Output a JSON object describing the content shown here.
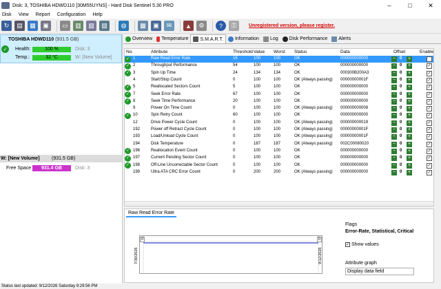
{
  "window": {
    "title": "Disk: 3, TOSHIBA HDWD110 [30M55UYNS]  -  Hard Disk Sentinel 5.30 PRO"
  },
  "menu": [
    "Disk",
    "View",
    "Report",
    "Configuration",
    "Help"
  ],
  "toolbar": {
    "unregistered": "Unregistered version, please register."
  },
  "disk": {
    "name": "TOSHIBA HDWD110",
    "size": "(931.5 GB)",
    "health_label": "Health:",
    "health_value": "100 %",
    "health_percent": 100,
    "health_disk": "Disk: 3",
    "temp_label": "Temp.:",
    "temp_value": "32 °C",
    "temp_volume": "W: [New Volume]"
  },
  "volume": {
    "name": "W: [New Volume]",
    "size": "(931.5 GB)",
    "free_label": "Free Space",
    "free_value": "931.4 GB",
    "free_disk": "Disk: 3"
  },
  "tabs": [
    "Overview",
    "Temperature",
    "S.M.A.R.T.",
    "Information",
    "Log",
    "Disk Performance",
    "Alerts"
  ],
  "smart": {
    "columns": [
      "No.",
      "Attribute",
      "Threshold",
      "Value",
      "Worst",
      "Status",
      "Data",
      "Offset",
      "Enable"
    ],
    "rows": [
      {
        "no": "1",
        "attr": "Raw Read Error Rate",
        "thr": "16",
        "val": "100",
        "worst": "100",
        "status": "OK",
        "data": "000000000000",
        "ok": true,
        "sel": true
      },
      {
        "no": "2",
        "attr": "Throughput Performance",
        "thr": "54",
        "val": "100",
        "worst": "100",
        "status": "OK",
        "data": "000000000000",
        "ok": true
      },
      {
        "no": "3",
        "attr": "Spin Up Time",
        "thr": "24",
        "val": "134",
        "worst": "134",
        "status": "OK",
        "data": "000300B200A3",
        "ok": true
      },
      {
        "no": "4",
        "attr": "Start/Stop Count",
        "thr": "0",
        "val": "100",
        "worst": "100",
        "status": "OK (Always passing)",
        "data": "00000000001F",
        "ok": false
      },
      {
        "no": "5",
        "attr": "Reallocated Sectors Count",
        "thr": "5",
        "val": "100",
        "worst": "100",
        "status": "OK",
        "data": "000000000000",
        "ok": true
      },
      {
        "no": "7",
        "attr": "Seek Error Rate",
        "thr": "67",
        "val": "100",
        "worst": "100",
        "status": "OK",
        "data": "000000000000",
        "ok": true
      },
      {
        "no": "8",
        "attr": "Seek Time Performance",
        "thr": "20",
        "val": "100",
        "worst": "100",
        "status": "OK",
        "data": "000000000000",
        "ok": true
      },
      {
        "no": "9",
        "attr": "Power On Time Count",
        "thr": "0",
        "val": "100",
        "worst": "100",
        "status": "OK (Always passing)",
        "data": "000000000008",
        "ok": false
      },
      {
        "no": "10",
        "attr": "Spin Retry Count",
        "thr": "60",
        "val": "100",
        "worst": "100",
        "status": "OK",
        "data": "000000000000",
        "ok": true
      },
      {
        "no": "12",
        "attr": "Drive Power Cycle Count",
        "thr": "0",
        "val": "100",
        "worst": "100",
        "status": "OK (Always passing)",
        "data": "000000000019",
        "ok": false
      },
      {
        "no": "192",
        "attr": "Power off Retract Cycle Count",
        "thr": "0",
        "val": "100",
        "worst": "100",
        "status": "OK (Always passing)",
        "data": "00000000001F",
        "ok": false
      },
      {
        "no": "193",
        "attr": "Load/Unload Cycle Count",
        "thr": "0",
        "val": "100",
        "worst": "100",
        "status": "OK (Always passing)",
        "data": "00000000001F",
        "ok": false
      },
      {
        "no": "194",
        "attr": "Disk Temperature",
        "thr": "0",
        "val": "187",
        "worst": "187",
        "status": "OK (Always passing)",
        "data": "002C00080020",
        "ok": false
      },
      {
        "no": "196",
        "attr": "Reallocation Event Count",
        "thr": "0",
        "val": "100",
        "worst": "100",
        "status": "OK",
        "data": "000000000000",
        "ok": true
      },
      {
        "no": "197",
        "attr": "Current Pending Sector Count",
        "thr": "0",
        "val": "100",
        "worst": "100",
        "status": "OK",
        "data": "000000000000",
        "ok": true
      },
      {
        "no": "198",
        "attr": "Off-Line Uncorrectable Sector Count",
        "thr": "0",
        "val": "100",
        "worst": "100",
        "status": "OK",
        "data": "000000000000",
        "ok": true
      },
      {
        "no": "199",
        "attr": "Ultra ATA CRC Error Count",
        "thr": "0",
        "val": "200",
        "worst": "200",
        "status": "OK (Always passing)",
        "data": "000000000000",
        "ok": false
      }
    ],
    "offset_value": "0"
  },
  "bottom": {
    "tab": "Raw Read Error Rate",
    "graph_left_value": "0",
    "graph_right_value": "0",
    "date_left": "7/30/2026",
    "date_right": "9/12/2026",
    "flags_label": "Flags",
    "flags_value": "Error-Rate, Statistical, Critical",
    "show_values": "Show values",
    "attr_graph_label": "Attribute graph",
    "attr_graph_select": "Display data field"
  },
  "status": {
    "text": "Status last updated: 9/12/2026 Saturday 9:29:56 PM"
  }
}
